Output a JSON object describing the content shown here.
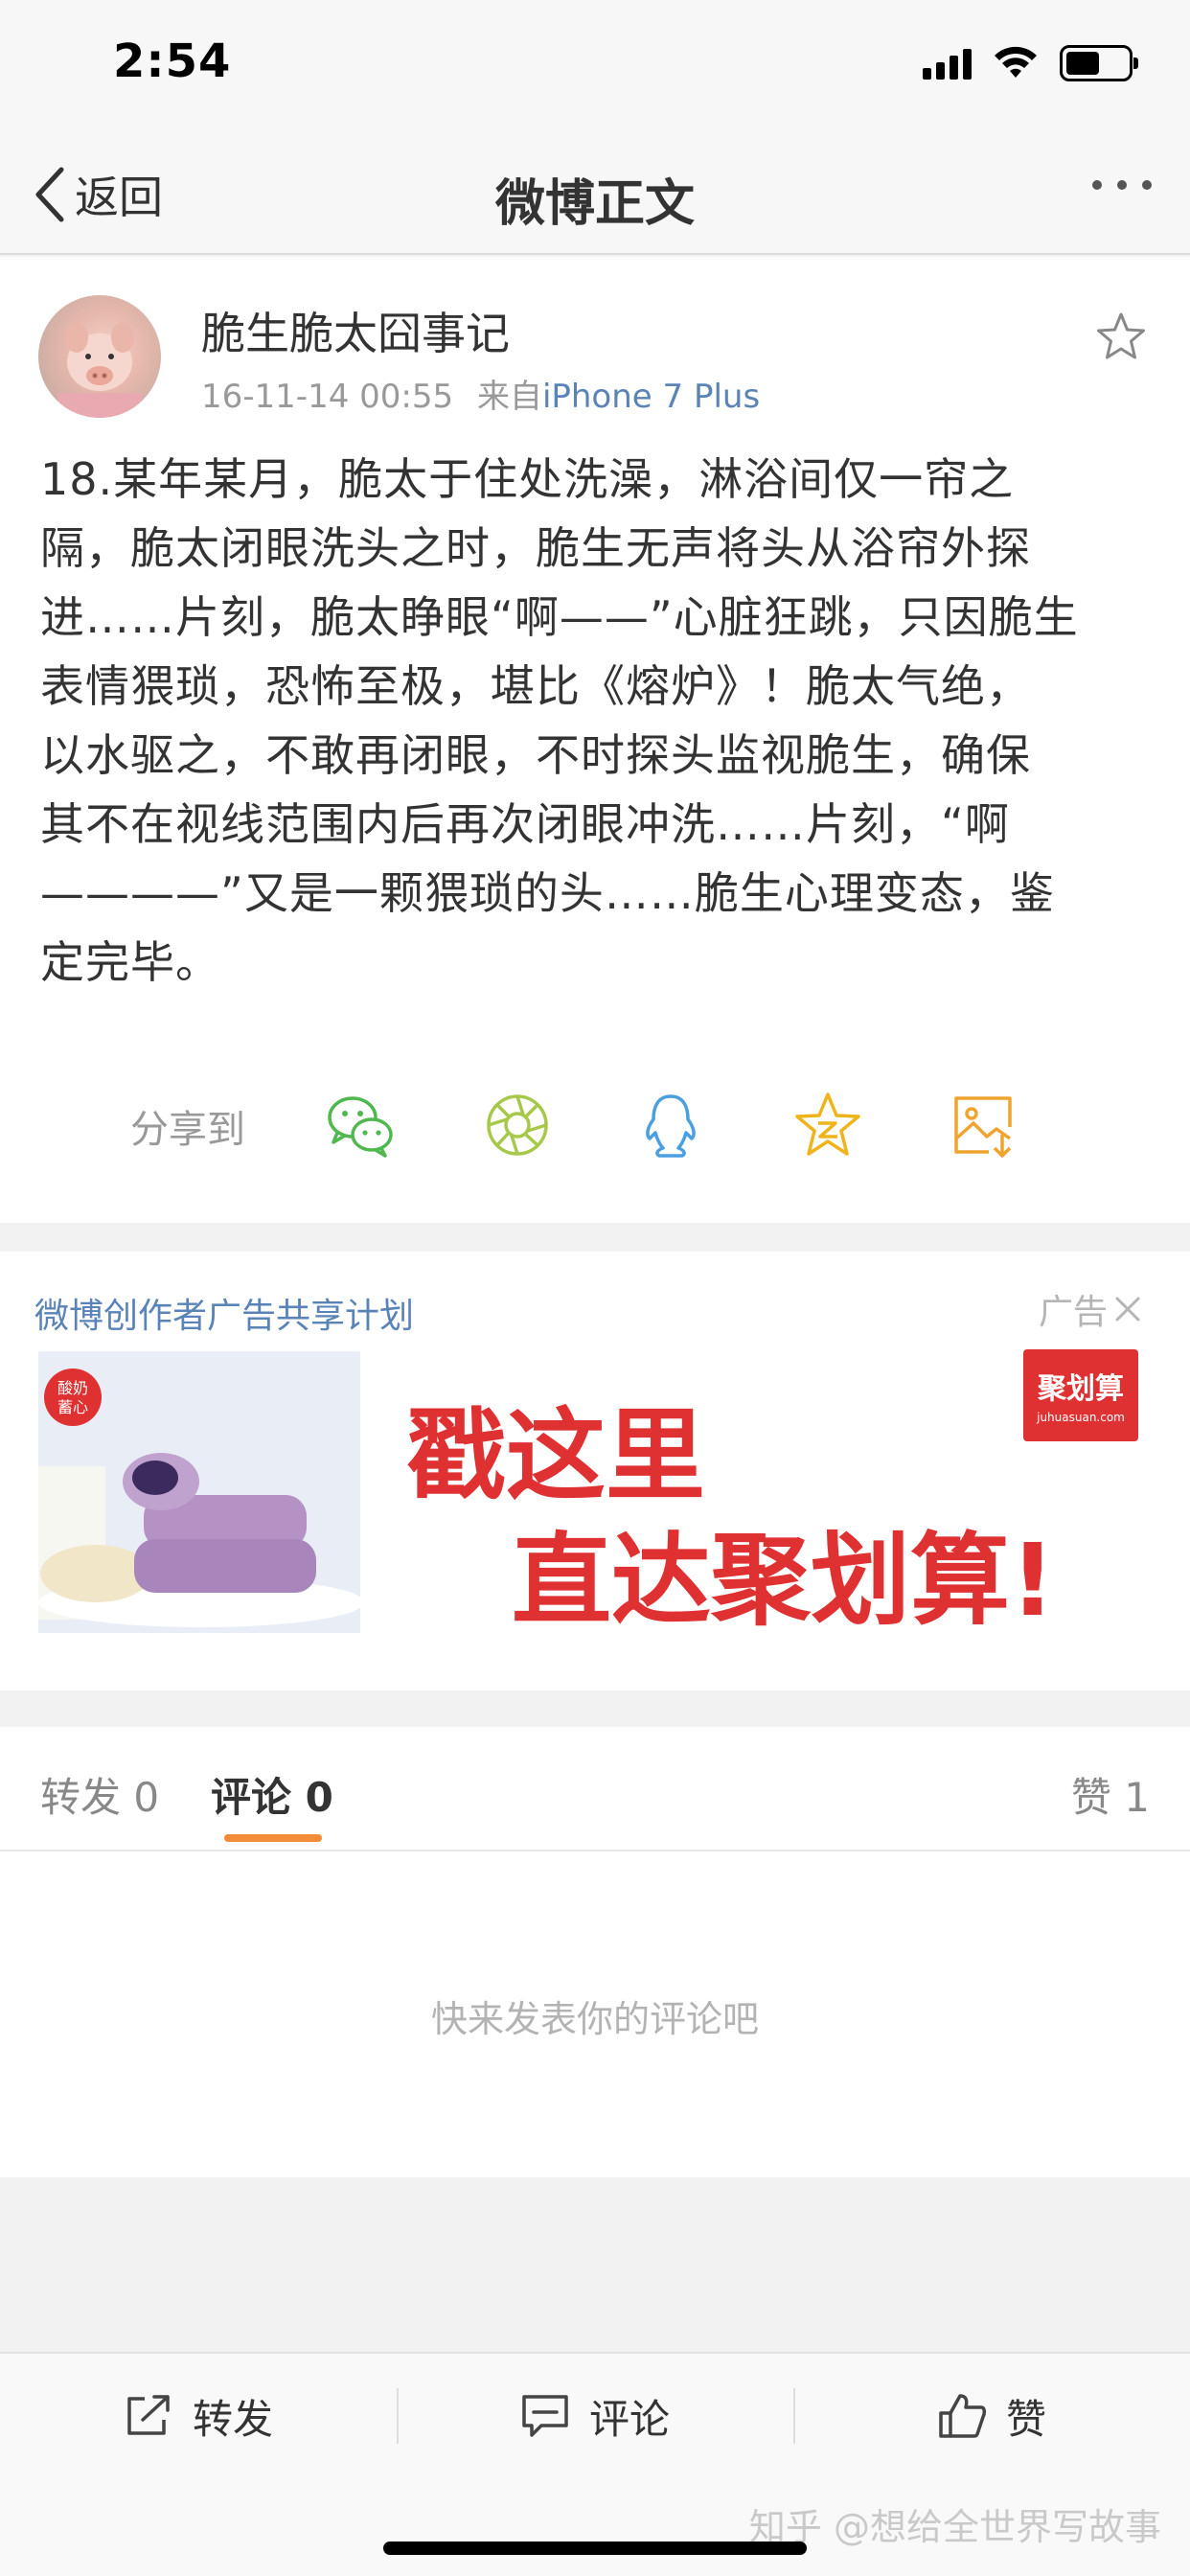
{
  "status_bar": {
    "time": "2:54",
    "battery_level": 0.55
  },
  "nav": {
    "back_label": "返回",
    "title": "微博正文"
  },
  "post": {
    "author": "脆生脆太囧事记",
    "time": "16-11-14 00:55",
    "source_prefix": "来自",
    "source": "iPhone 7 Plus",
    "lines": [
      "18.某年某月，脆太于住处洗澡，淋浴间仅一帘之",
      "隔，脆太闭眼洗头之时，脆生无声将头从浴帘外探",
      "进……片刻，脆太睁眼“啊——”心脏狂跳，只因脆生",
      "表情猥琐，恐怖至极，堪比《熔炉》！脆太气绝，",
      "以水驱之，不敢再闭眼，不时探头监视脆生，确保",
      "其不在视线范围内后再次闭眼冲洗……片刻，“啊",
      "————”又是一颗猥琐的头……脆生心理变态，鉴",
      "定完毕。"
    ],
    "share_label": "分享到",
    "share_icons": [
      "wechat-icon",
      "moments-icon",
      "qq-icon",
      "qzone-icon",
      "save-image-icon"
    ]
  },
  "ad": {
    "title": "微博创作者广告共享计划",
    "tag": "广告",
    "headline_1": "戳这里",
    "headline_2": "直达聚划算!",
    "logo_text": "聚划算",
    "logo_domain": "juhuasuan.com",
    "image_badge": "酸奶\n蓄心"
  },
  "tabs": {
    "repost": "转发 0",
    "comment": "评论 0",
    "like": "赞 1"
  },
  "comments": {
    "empty_text": "快来发表你的评论吧"
  },
  "toolbar": {
    "repost": "转发",
    "comment": "评论",
    "like": "赞"
  },
  "watermark": "知乎 @想给全世界写故事",
  "colors": {
    "accent": "#f28c38",
    "link": "#5a84b8",
    "ad_red": "#e03132"
  }
}
